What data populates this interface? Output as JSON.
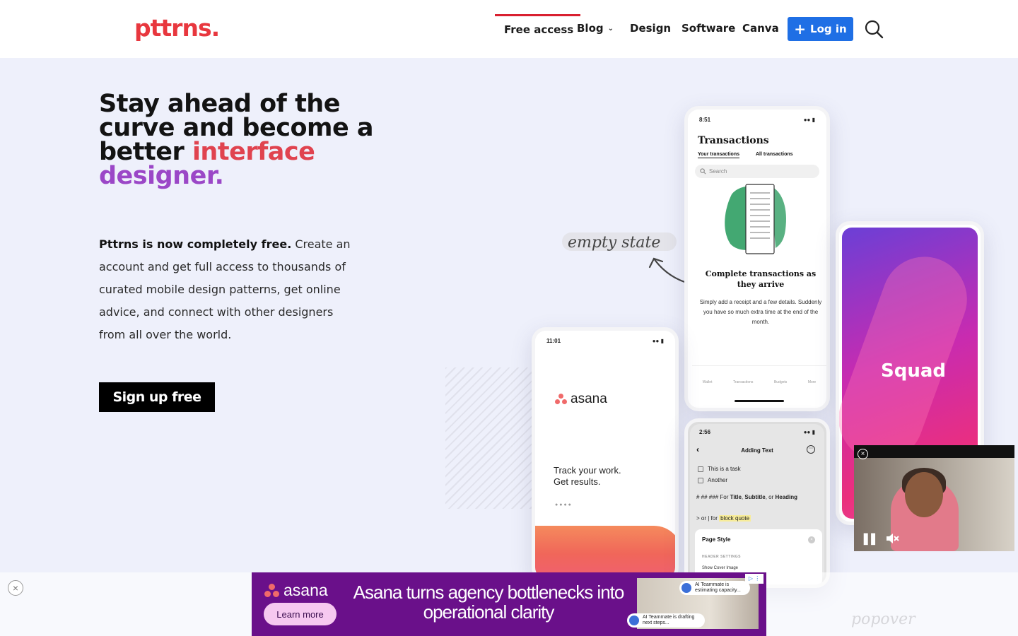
{
  "brand": {
    "logo": "pttrns.",
    "accent": "#e8373e"
  },
  "nav": {
    "items": [
      {
        "label": "Free access",
        "active": true
      },
      {
        "label": "Blog",
        "has_dropdown": true
      },
      {
        "label": "Design"
      },
      {
        "label": "Software"
      },
      {
        "label": "Canva"
      }
    ],
    "login_label": "Log in",
    "login_color": "#1f6fe5"
  },
  "hero": {
    "headline_plain": "Stay ahead of the curve and become a better ",
    "headline_red": "interface",
    "headline_purple": "designer.",
    "intro_bold": "Pttrns is now completely free.",
    "intro_rest": " Create an account and get full access to thousands of curated mobile design patterns, get online advice, and connect with other designers from all over the world.",
    "cta_label": "Sign up free"
  },
  "annotations": {
    "empty_state": "empty state",
    "popover": "popover"
  },
  "phones": {
    "transactions": {
      "time": "8:51",
      "title": "Transactions",
      "tab_mine": "Your transactions",
      "tab_all": "All transactions",
      "search_placeholder": "Search",
      "heading": "Complete transactions as they arrive",
      "body": "Simply add a receipt and a few details. Suddenly you have so much extra time at the end of the month.",
      "tabbar": [
        "Wallet",
        "Transactions",
        "Budgets",
        "More"
      ]
    },
    "asana": {
      "time": "11:01",
      "logo": "asana",
      "tagline_1": "Track your work.",
      "tagline_2": "Get results."
    },
    "squad": {
      "label": "Squad"
    },
    "notes": {
      "time": "2:56",
      "title": "Adding Text",
      "task_1": "This is a task",
      "task_2": "Another",
      "markdown_prefix": "#  ##  ###  For ",
      "markdown_title": "Title",
      "markdown_sep": ", ",
      "markdown_subtitle": "Subtitle",
      "markdown_or": ", or ",
      "markdown_heading": "Heading",
      "quote_prefix": ">  or  |  for ",
      "quote_highlight": "block quote",
      "sheet_title": "Page Style",
      "sheet_section": "HEADER SETTINGS",
      "sheet_item": "Show Cover Image"
    }
  },
  "ad": {
    "logo": "asana",
    "cta": "Learn more",
    "headline": "Asana turns agency bottlenecks into operational clarity",
    "bubble_1": "AI Teammate is estimating capacity...",
    "bubble_2": "AI Teammate is drafting next steps...",
    "background": "#6a108a"
  }
}
